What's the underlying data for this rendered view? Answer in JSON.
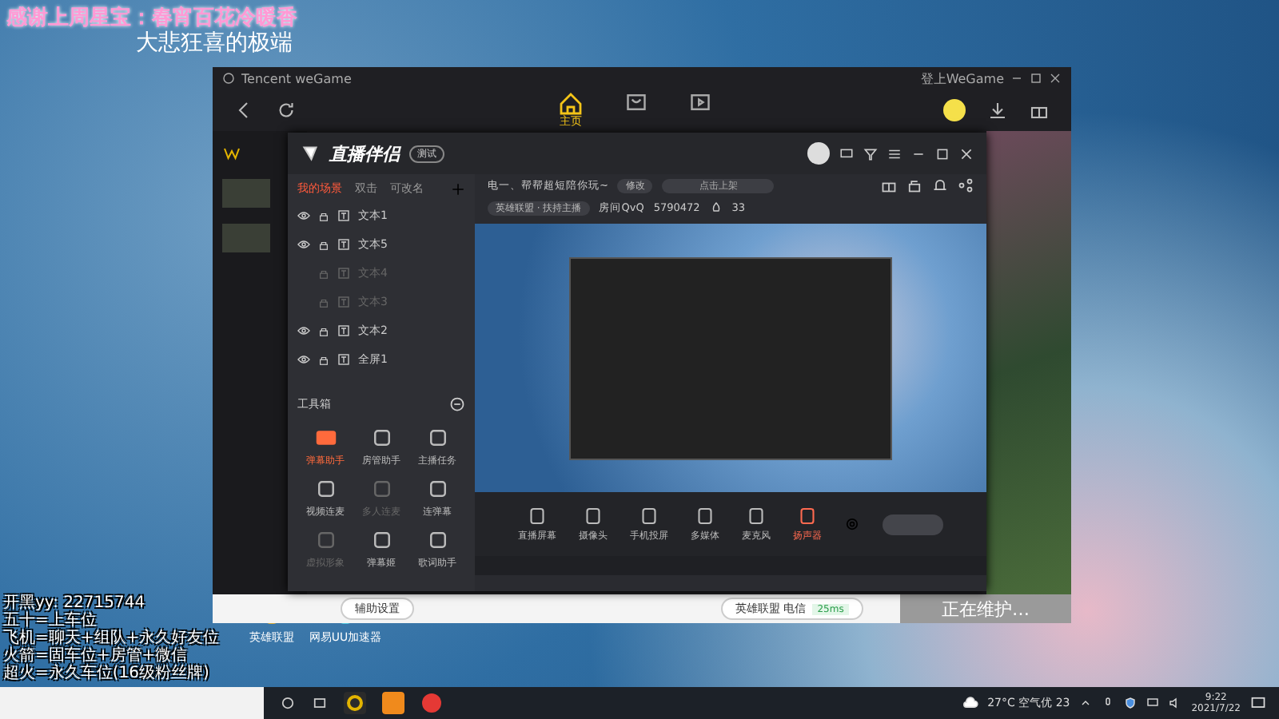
{
  "overlay": {
    "thanks": "感谢上周星宝：春宵百花冷暖香",
    "subtitle": "大悲狂喜的极端",
    "notes": [
      "开黑yy: 22715744",
      "五十=上车位",
      "飞机=聊天+组队+永久好友位",
      "火箭=固车位+房管+微信",
      "超火=永久车位(16级粉丝牌)"
    ]
  },
  "desktop_icons": [
    {
      "label": "英雄联盟"
    },
    {
      "label": "网易UU加速器"
    }
  ],
  "wegame": {
    "title": "Tencent weGame",
    "login": "登上WeGame",
    "nav": [
      {
        "kind": "home",
        "label": "主页",
        "selected": true
      },
      {
        "kind": "store",
        "selected": false
      },
      {
        "kind": "video",
        "selected": false
      }
    ],
    "footer": {
      "assist": "辅助设置",
      "game": "英雄联盟 电信",
      "ping": "25ms",
      "maintenance": "正在维护…"
    }
  },
  "companion": {
    "title": "直播伴侣",
    "beta": "测试",
    "scene_tabs": [
      {
        "label": "我的场景",
        "selected": true
      },
      {
        "label": "双击",
        "selected": false
      },
      {
        "label": "可改名",
        "selected": false
      }
    ],
    "scenes": [
      {
        "label": "文本1",
        "visible": true
      },
      {
        "label": "文本5",
        "visible": true
      },
      {
        "label": "文本4",
        "visible": false
      },
      {
        "label": "文本3",
        "visible": false
      },
      {
        "label": "文本2",
        "visible": true
      },
      {
        "label": "全屏1",
        "visible": true
      }
    ],
    "toolbox": "工具箱",
    "tools": [
      {
        "label": "弹幕助手",
        "active": true,
        "disabled": false
      },
      {
        "label": "房管助手",
        "active": false,
        "disabled": false
      },
      {
        "label": "主播任务",
        "active": false,
        "disabled": false
      },
      {
        "label": "视频连麦",
        "active": false,
        "disabled": false
      },
      {
        "label": "多人连麦",
        "active": false,
        "disabled": true
      },
      {
        "label": "连弹幕",
        "active": false,
        "disabled": false
      },
      {
        "label": "虚拟形象",
        "active": false,
        "disabled": true
      },
      {
        "label": "弹幕姬",
        "active": false,
        "disabled": false
      },
      {
        "label": "歌词助手",
        "active": false,
        "disabled": false
      }
    ],
    "stream_title": "电一、帮帮超短陪你玩~",
    "edit": "修改",
    "cover": "点击上架",
    "category": "英雄联盟 · 扶持主播",
    "room": "房间QvQ",
    "room_id": "5790472",
    "hot": "33",
    "sources": [
      {
        "label": "直播屏幕",
        "active": false
      },
      {
        "label": "摄像头",
        "active": false
      },
      {
        "label": "手机投屏",
        "active": false
      },
      {
        "label": "多媒体",
        "active": false
      },
      {
        "label": "麦克风",
        "active": false
      },
      {
        "label": "扬声器",
        "active": true
      }
    ]
  },
  "taskbar": {
    "weather": "27°C 空气优 23",
    "time": "9:22",
    "date": "2021/7/22"
  }
}
